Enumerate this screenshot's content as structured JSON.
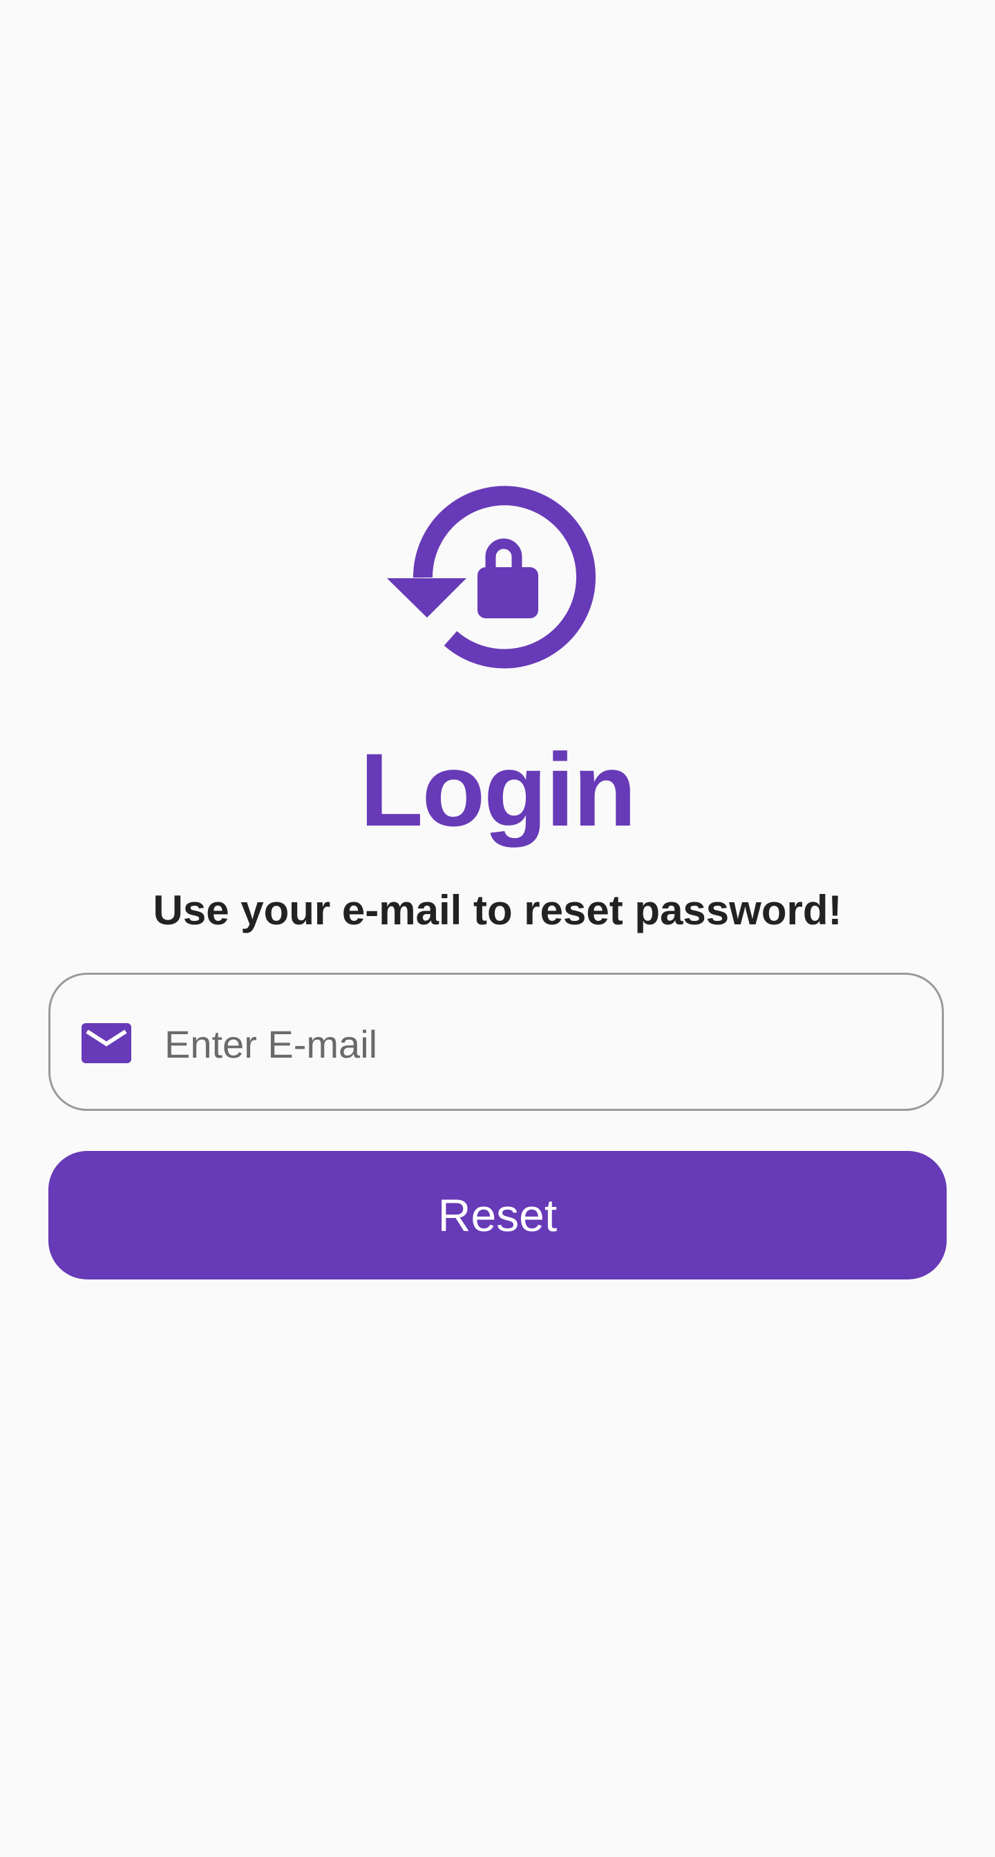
{
  "colors": {
    "accent": "#673ab7",
    "background": "#fafafa",
    "subtitle_text": "#222222",
    "field_border": "#9a9a9a",
    "button_text": "#ffffff"
  },
  "hero": {
    "icon": "lock-reset-icon"
  },
  "header": {
    "title": "Login",
    "subtitle": "Use your e-mail to reset password!"
  },
  "form": {
    "email": {
      "icon": "mail-icon",
      "value": "",
      "placeholder": "Enter E-mail"
    },
    "reset_label": "Reset"
  }
}
